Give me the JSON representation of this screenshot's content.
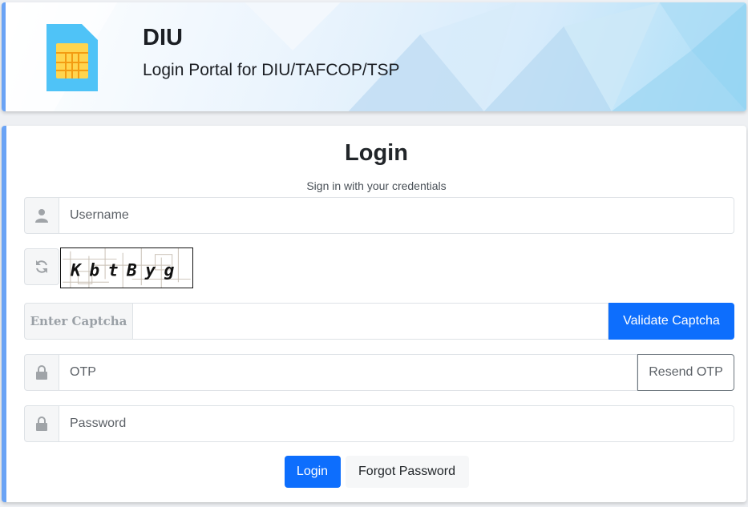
{
  "header": {
    "title": "DIU",
    "subtitle": "Login Portal for DIU/TAFCOP/TSP",
    "logo_icon": "sim-card-icon"
  },
  "login": {
    "title": "Login",
    "subtitle": "Sign in with your credentials",
    "username_placeholder": "Username",
    "captcha_text": "KbtByg",
    "captcha_label": "Enter Captcha",
    "validate_label": "Validate Captcha",
    "otp_placeholder": "OTP",
    "resend_label": "Resend OTP",
    "password_placeholder": "Password",
    "login_label": "Login",
    "forgot_label": "Forgot Password"
  },
  "colors": {
    "primary": "#0d6efd",
    "accent_border": "#6aa3f5"
  }
}
